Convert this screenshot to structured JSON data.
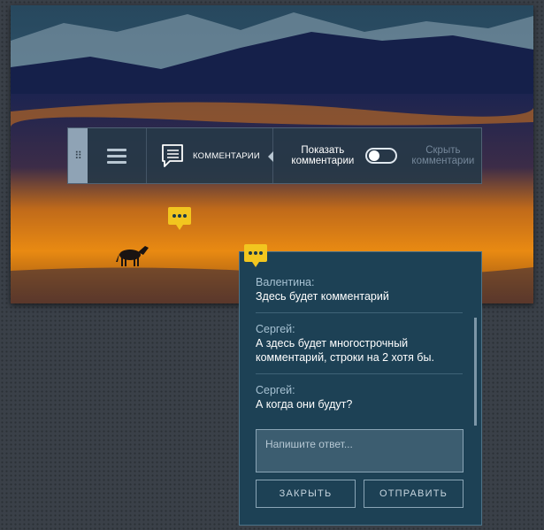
{
  "toolbar": {
    "comments_label": "КОММЕНТАРИИ",
    "show_comments": "Показать комментарии",
    "hide_comments": "Скрыть комментарии",
    "toggle_on": false
  },
  "panel": {
    "comments": [
      {
        "author": "Валентина:",
        "text": "Здесь будет комментарий"
      },
      {
        "author": "Сергей:",
        "text": "А здесь будет многострочный комментарий, строки на 2 хотя бы."
      },
      {
        "author": "Сергей:",
        "text": "А когда они будут?"
      }
    ],
    "reply_placeholder": "Напишите ответ...",
    "close_label": "ЗАКРЫТЬ",
    "send_label": "ОТПРАВИТЬ"
  },
  "icons": {
    "drag": "drag-handle-icon",
    "menu": "hamburger-menu-icon",
    "comments": "comment-list-icon",
    "marker": "ellipsis-speech-icon"
  },
  "colors": {
    "marker": "#f2c61f",
    "panel_bg": "#1d4155",
    "toolbar_bg": "#263848",
    "handle": "#8fa3b5"
  }
}
